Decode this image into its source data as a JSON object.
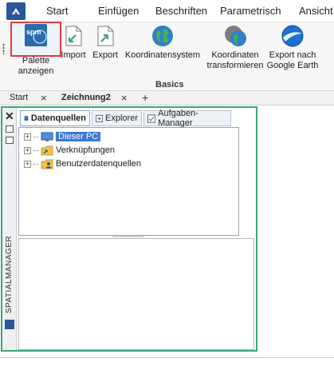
{
  "ribbon_tabs": [
    "Start",
    "Einfügen",
    "Beschriften",
    "Parametrisch",
    "Ansicht"
  ],
  "ribbon_buttons": {
    "palette": "Palette anzeigen",
    "import": "Import",
    "export": "Export",
    "coord_system": "Koordinatensystem",
    "transform": "Koordinaten transformieren",
    "google_earth": "Export nach Google Earth"
  },
  "palette_icon_text": "spm",
  "ribbon_group": "Basics",
  "doc_tabs": {
    "start": "Start",
    "drawing": "Zeichnung2",
    "close": "×",
    "add": "+"
  },
  "palette": {
    "title": "SPATIALMANAGER",
    "close": "✕",
    "tabs": [
      "Datenquellen",
      "Explorer",
      "Aufgaben-Manager"
    ],
    "tree": [
      "Dieser PC",
      "Verknüpfungen",
      "Benutzerdatenquellen"
    ]
  },
  "colors": {
    "accent_green": "#3aa876",
    "highlight_red": "#e23b3b",
    "selection_blue": "#3b78d8",
    "app_blue": "#2b5797"
  }
}
